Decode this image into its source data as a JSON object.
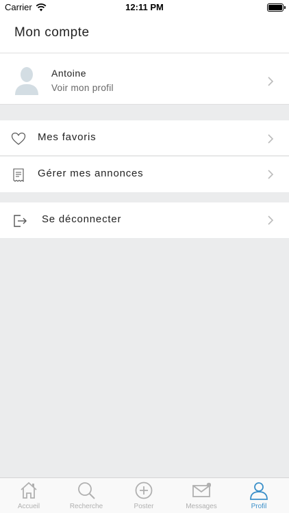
{
  "status_bar": {
    "carrier": "Carrier",
    "time": "12:11 PM"
  },
  "header": {
    "title": "Mon compte"
  },
  "profile": {
    "name": "Antoine",
    "link": "Voir mon profil"
  },
  "menu": {
    "favorites": "Mes favoris",
    "manage_ads": "Gérer mes annonces",
    "logout": "Se déconnecter"
  },
  "tabbar": {
    "tabs": [
      {
        "label": "Accueil",
        "icon": "home-icon"
      },
      {
        "label": "Recherche",
        "icon": "search-icon"
      },
      {
        "label": "Poster",
        "icon": "plus-circle-icon"
      },
      {
        "label": "Messages",
        "icon": "mail-icon"
      },
      {
        "label": "Profil",
        "icon": "user-icon",
        "active": true
      }
    ]
  },
  "colors": {
    "accent": "#3a8fc9",
    "background": "#ebeced",
    "inactive": "#b0b0b0"
  }
}
